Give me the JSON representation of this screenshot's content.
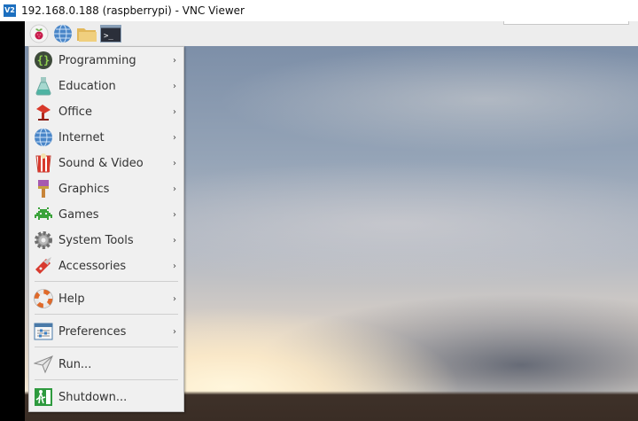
{
  "window": {
    "title": "192.168.0.188 (raspberrypi) - VNC Viewer",
    "logo_text": "V2"
  },
  "taskbar": {
    "buttons": [
      {
        "icon": "raspberry-icon"
      },
      {
        "icon": "globe-icon"
      },
      {
        "icon": "folder-icon"
      },
      {
        "icon": "terminal-icon",
        "text": ">_"
      }
    ]
  },
  "menu": {
    "items": [
      {
        "label": "Programming",
        "icon": "programming-icon",
        "submenu": true
      },
      {
        "label": "Education",
        "icon": "education-flask-icon",
        "submenu": true
      },
      {
        "label": "Office",
        "icon": "office-icon",
        "submenu": true
      },
      {
        "label": "Internet",
        "icon": "internet-globe-icon",
        "submenu": true
      },
      {
        "label": "Sound & Video",
        "icon": "sound-video-icon",
        "submenu": true
      },
      {
        "label": "Graphics",
        "icon": "graphics-brush-icon",
        "submenu": true
      },
      {
        "label": "Games",
        "icon": "games-invader-icon",
        "submenu": true
      },
      {
        "label": "System Tools",
        "icon": "system-tools-gear-icon",
        "submenu": true
      },
      {
        "label": "Accessories",
        "icon": "accessories-knife-icon",
        "submenu": true
      },
      {
        "label": "Help",
        "icon": "help-lifebuoy-icon",
        "submenu": true
      },
      {
        "label": "Preferences",
        "icon": "preferences-icon",
        "submenu": true
      },
      {
        "label": "Run...",
        "icon": "run-paper-plane-icon",
        "submenu": false
      },
      {
        "label": "Shutdown...",
        "icon": "shutdown-exit-icon",
        "submenu": false
      }
    ],
    "arrow_glyph": "›"
  }
}
